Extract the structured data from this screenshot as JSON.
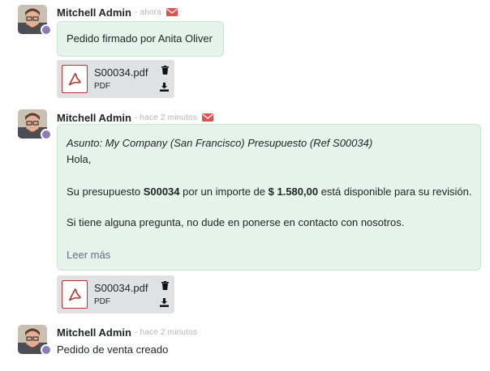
{
  "messages": [
    {
      "author": "Mitchell Admin",
      "date": "- ahora",
      "body": "Pedido firmado por Anita Oliver",
      "attachment": {
        "name": "S00034.pdf",
        "type": "PDF"
      }
    },
    {
      "author": "Mitchell Admin",
      "date": "- hace 2 minutos",
      "subject": "Asunto: My Company (San Francisco) Presupuesto (Ref S00034)",
      "greeting": "Hola,",
      "line1_pre": "Su presupuesto ",
      "line1_ref": "S00034",
      "line1_mid": " por un importe de ",
      "line1_amount": "$ 1.580,00",
      "line1_post": " está disponible para su revisión.",
      "line2": "Si tiene alguna pregunta, no dude en ponerse en contacto con nosotros.",
      "read_more": "Leer más",
      "attachment": {
        "name": "S00034.pdf",
        "type": "PDF"
      }
    },
    {
      "author": "Mitchell Admin",
      "date": "- hace 2 minutos",
      "body": "Pedido de venta creado"
    }
  ],
  "colors": {
    "envelope": "#d9534f",
    "pdf": "#b8322c",
    "bubble": "#e6f3ea",
    "presence": "#8e7bb7"
  }
}
